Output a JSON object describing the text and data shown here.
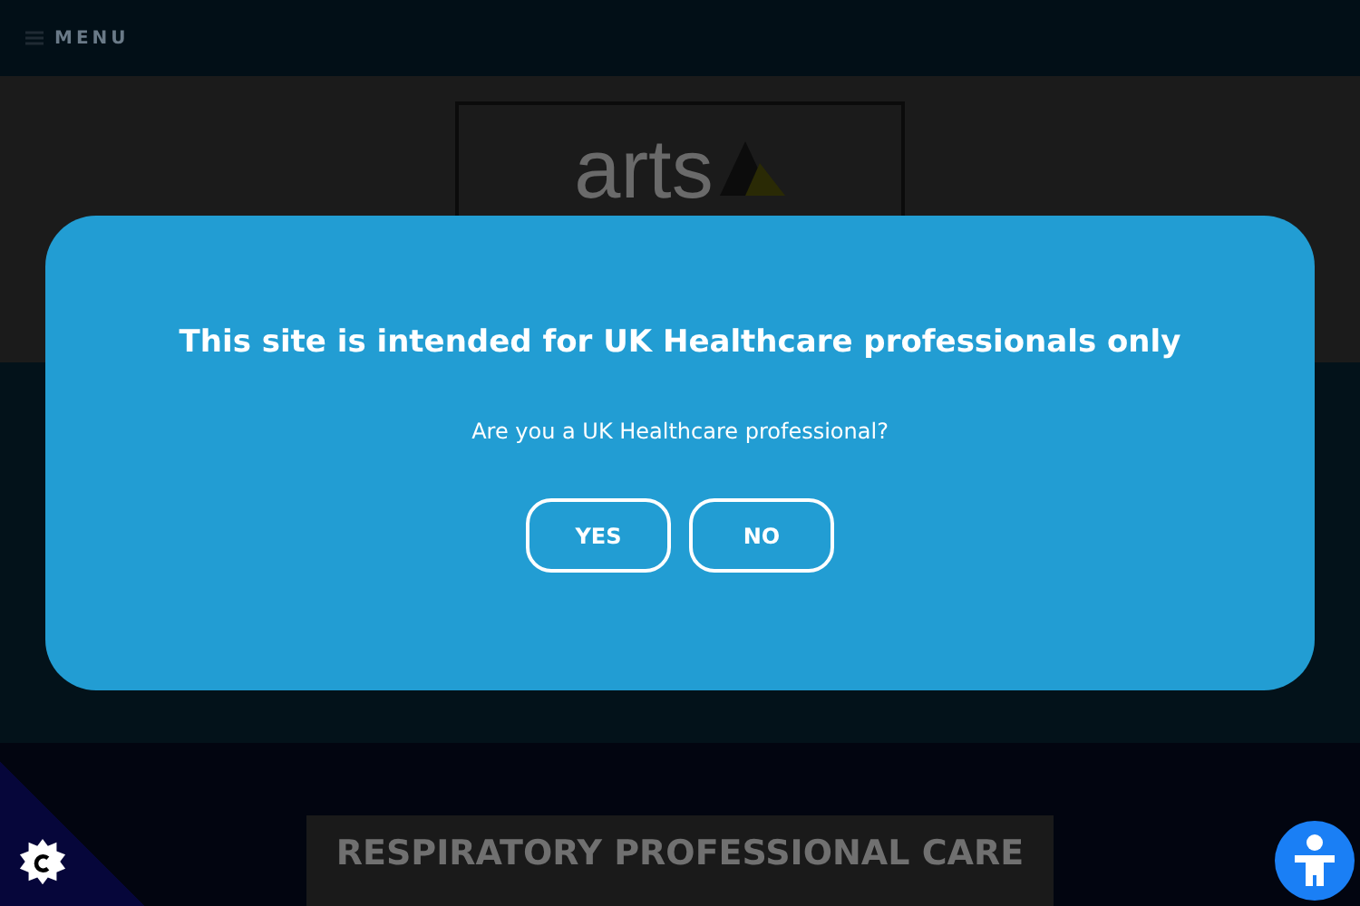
{
  "header": {
    "menu_label": "MENU"
  },
  "logo": {
    "text": "arts"
  },
  "modal": {
    "title": "This site is intended for UK Healthcare professionals only",
    "question": "Are you a UK Healthcare professional?",
    "buttons": [
      "YES",
      "NO"
    ]
  },
  "section": {
    "title": "RESPIRATORY PROFESSIONAL CARE"
  }
}
